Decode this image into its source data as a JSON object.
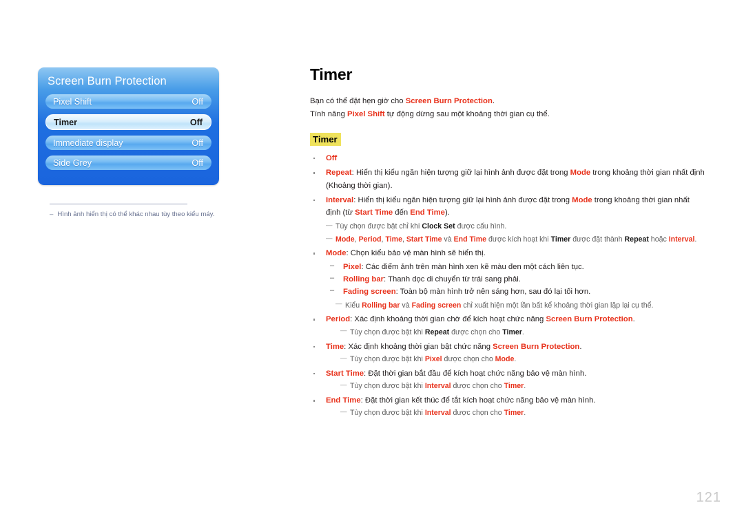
{
  "osd": {
    "title": "Screen Burn Protection",
    "rows": [
      {
        "label": "Pixel Shift",
        "value": "Off",
        "selected": false
      },
      {
        "label": "Timer",
        "value": "Off",
        "selected": true
      },
      {
        "label": "Immediate display",
        "value": "Off",
        "selected": false
      },
      {
        "label": "Side Grey",
        "value": "Off",
        "selected": false
      }
    ],
    "note_dash": "–",
    "note": "Hình ảnh hiển thị có thể khác nhau tùy theo kiểu máy."
  },
  "page": {
    "title": "Timer",
    "intro_1_a": "Bạn có thể đặt hẹn giờ cho ",
    "intro_1_b": "Screen Burn Protection",
    "intro_1_c": ".",
    "intro_2_a": "Tính năng ",
    "intro_2_b": "Pixel Shift",
    "intro_2_c": " tự động dừng sau một khoảng thời gian cụ thể.",
    "section_heading": "Timer",
    "page_number": "121"
  },
  "items": {
    "off_label": "Off",
    "repeat_label": "Repeat",
    "repeat_t1": ": Hiển thị kiểu ngăn hiện tượng giữ lại hình ảnh được đặt trong ",
    "repeat_mode": "Mode",
    "repeat_t2": " trong khoảng thời gian nhất định (Khoảng thời gian).",
    "interval_label": "Interval",
    "interval_t1": ": Hiển thị kiểu ngăn hiện tượng giữ lại hình ảnh được đặt trong ",
    "interval_mode": "Mode",
    "interval_t2": " trong khoảng thời gian nhất định (từ ",
    "interval_start": "Start Time",
    "interval_t3": " đến ",
    "interval_end": "End Time",
    "interval_t4": ").",
    "note_clockset_a": "Tùy chọn được bật chỉ khi ",
    "note_clockset_b": "Clock Set",
    "note_clockset_c": " được cấu hình.",
    "note_modes_a": "Mode",
    "note_modes_b": ", ",
    "note_modes_c": "Period",
    "note_modes_d": ", ",
    "note_modes_e": "Time",
    "note_modes_f": ", ",
    "note_modes_g": "Start Time",
    "note_modes_h": " và ",
    "note_modes_i": "End Time",
    "note_modes_j": " được kích hoạt khi ",
    "note_modes_k": "Timer",
    "note_modes_l": " được đặt thành ",
    "note_modes_m": "Repeat",
    "note_modes_n": " hoặc ",
    "note_modes_o": "Interval",
    "note_modes_p": ".",
    "mode_label": "Mode",
    "mode_t1": ": Chọn kiểu bảo vệ màn hình sẽ hiển thị.",
    "pixel_label": "Pixel",
    "pixel_t1": ": Các điểm ảnh trên màn hình xen kẽ màu đen một cách liên tục.",
    "rollingbar_label": "Rolling bar",
    "rollingbar_t1": ": Thanh dọc di chuyển từ trái sang phải.",
    "fading_label": "Fading screen",
    "fading_t1": ": Toàn bộ màn hình trở nên sáng hơn, sau đó lại tối hơn.",
    "note_kieu_a": "Kiểu ",
    "note_kieu_b": "Rolling bar",
    "note_kieu_c": " và ",
    "note_kieu_d": "Fading screen",
    "note_kieu_e": " chỉ xuất hiện một lần bất kể khoảng thời gian lặp lại cụ thể.",
    "period_label": "Period",
    "period_t1": ": Xác định khoảng thời gian chờ để kích hoạt chức năng ",
    "period_sbp": "Screen Burn Protection",
    "period_t2": ".",
    "note_period_a": "Tùy chọn được bật khi ",
    "note_period_b": "Repeat",
    "note_period_c": " được chọn cho ",
    "note_period_d": "Timer",
    "note_period_e": ".",
    "time_label": "Time",
    "time_t1": ": Xác định khoảng thời gian bật chức năng ",
    "time_sbp": "Screen Burn Protection",
    "time_t2": ".",
    "note_time_a": "Tùy chọn được bật khi ",
    "note_time_b": "Pixel",
    "note_time_c": " được chọn cho ",
    "note_time_d": "Mode",
    "note_time_e": ".",
    "starttime_label": "Start Time",
    "starttime_t1": ": Đặt thời gian bắt đầu để kích hoạt chức năng bảo vệ màn hình.",
    "note_start_a": "Tùy chọn được bật khi ",
    "note_start_b": "Interval",
    "note_start_c": " được chọn cho ",
    "note_start_d": "Timer",
    "note_start_e": ".",
    "endtime_label": "End Time",
    "endtime_t1": ": Đặt thời gian kết thúc để tắt kích hoạt chức năng bảo vệ màn hình.",
    "note_end_a": "Tùy chọn được bật khi ",
    "note_end_b": "Interval",
    "note_end_c": " được chọn cho ",
    "note_end_d": "Timer",
    "note_end_e": "."
  }
}
